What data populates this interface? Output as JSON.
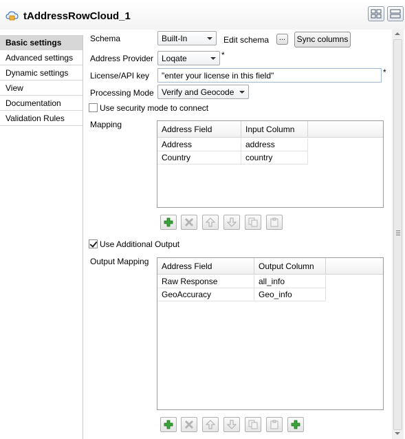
{
  "window": {
    "title": "tAddressRowCloud_1"
  },
  "sidebar": {
    "items": [
      {
        "label": "Basic settings"
      },
      {
        "label": "Advanced settings"
      },
      {
        "label": "Dynamic settings"
      },
      {
        "label": "View"
      },
      {
        "label": "Documentation"
      },
      {
        "label": "Validation Rules"
      }
    ]
  },
  "form": {
    "schema_label": "Schema",
    "schema_value": "Built-In",
    "edit_schema_label": "Edit schema",
    "edit_schema_button": "...",
    "sync_columns_button": "Sync columns",
    "address_provider_label": "Address Provider",
    "address_provider_value": "Loqate",
    "required_mark": "*",
    "license_label": "License/API key",
    "license_value": "\"enter your license in this field\"",
    "processing_mode_label": "Processing Mode",
    "processing_mode_value": "Verify and Geocode",
    "security_mode_label": "Use security mode to connect",
    "security_mode_checked": false,
    "use_additional_output_label": "Use Additional Output",
    "use_additional_output_checked": true
  },
  "mapping": {
    "label": "Mapping",
    "columns": [
      "Address Field",
      "Input Column"
    ],
    "rows": [
      [
        "Address",
        "address"
      ],
      [
        "Country",
        "country"
      ]
    ]
  },
  "output_mapping": {
    "label": "Output Mapping",
    "columns": [
      "Address Field",
      "Output Column"
    ],
    "rows": [
      [
        "Raw Response",
        "all_info"
      ],
      [
        "GeoAccuracy",
        "Geo_info"
      ]
    ]
  },
  "icons": {
    "add": "plus-icon",
    "remove": "x-icon",
    "up": "arrow-up-icon",
    "down": "arrow-down-icon",
    "copy": "copy-icon",
    "paste": "paste-icon",
    "add_green": "plus-icon"
  },
  "colors": {
    "add_green": "#3aa53a",
    "active_tab": "#d7d7d7",
    "input_border": "#9fb7d0"
  }
}
